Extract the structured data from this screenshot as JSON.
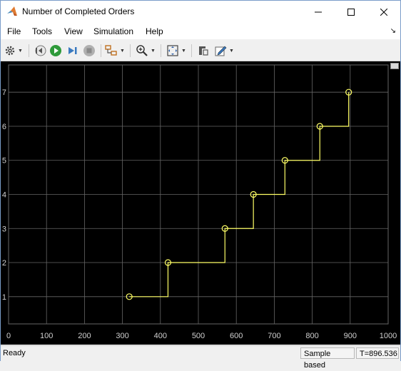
{
  "window": {
    "title": "Number of Completed Orders",
    "minimize_icon": "minimize-icon",
    "maximize_icon": "maximize-icon",
    "close_icon": "close-icon"
  },
  "menu": {
    "items": [
      "File",
      "Tools",
      "View",
      "Simulation",
      "Help"
    ]
  },
  "toolbar": {
    "icons": [
      "gear-icon",
      "step-back-icon",
      "run-icon",
      "step-forward-icon",
      "stop-icon",
      "triggers-icon",
      "zoom-icon",
      "autoscale-icon",
      "cursor-measurements-icon",
      "style-icon"
    ]
  },
  "status": {
    "text": "Ready",
    "mode": "Sample based",
    "time": "T=896.536"
  },
  "colors": {
    "plot_background": "#000000",
    "grid": "#666666",
    "line": "#ffff66",
    "tick_label": "#d0d0d0"
  },
  "chart_data": {
    "type": "line",
    "style": "stairs-with-markers",
    "x": [
      318,
      420,
      570,
      645,
      728,
      820,
      896
    ],
    "y": [
      1,
      2,
      3,
      4,
      5,
      6,
      7
    ],
    "xlim": [
      0,
      1000
    ],
    "ylim": [
      0.2,
      7.8
    ],
    "xticks": [
      0,
      100,
      200,
      300,
      400,
      500,
      600,
      700,
      800,
      900,
      1000
    ],
    "yticks": [
      1,
      2,
      3,
      4,
      5,
      6,
      7
    ],
    "grid": true,
    "title": "",
    "xlabel": "",
    "ylabel": ""
  }
}
